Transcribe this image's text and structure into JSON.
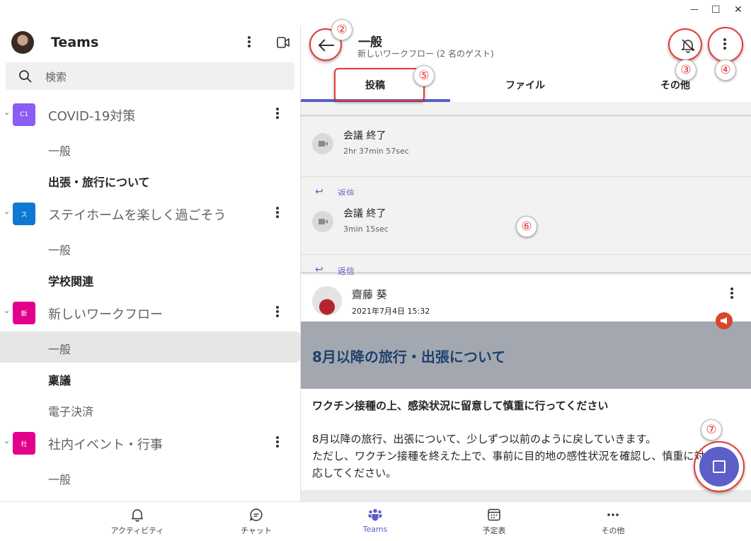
{
  "window": {
    "back_glyph": "←",
    "minimize_glyph": "—",
    "maximize_glyph": "☐",
    "close_glyph": "✕"
  },
  "left": {
    "title": "Teams",
    "search_placeholder": "検索",
    "teams": [
      {
        "badge": "C1",
        "name": "COVID-19対策",
        "color": "#8b5cf6",
        "channels": [
          {
            "name": "一般",
            "bold": false
          },
          {
            "name": "出張・旅行について",
            "bold": true
          }
        ]
      },
      {
        "badge": "ス",
        "name": "ステイホームを楽しく過ごそう",
        "color": "#0f78d4",
        "channels": [
          {
            "name": "一般",
            "bold": false
          },
          {
            "name": "学校関連",
            "bold": true
          }
        ]
      },
      {
        "badge": "新",
        "name": "新しいワークフロー",
        "color": "#e3008c",
        "channels": [
          {
            "name": "一般",
            "bold": false,
            "selected": true
          },
          {
            "name": "稟議",
            "bold": true
          },
          {
            "name": "電子決済",
            "bold": false
          }
        ]
      },
      {
        "badge": "社",
        "name": "社内イベント・行事",
        "color": "#e3008c",
        "channels": [
          {
            "name": "一般",
            "bold": false
          }
        ]
      }
    ]
  },
  "header": {
    "title": "一般",
    "subtitle": "新しいワークフロー (2 名のゲスト)"
  },
  "tabs": [
    "投稿",
    "ファイル",
    "その他"
  ],
  "feed": {
    "meetings": [
      {
        "title": "会議 終了",
        "duration": "2hr 37min 57sec",
        "reply": "返信"
      },
      {
        "title": "会議 終了",
        "duration": "3min 15sec",
        "reply": "返信"
      }
    ],
    "post": {
      "author": "齋藤 葵",
      "date": "2021年7月4日 15:32",
      "banner_title": "8月以降の旅行・出張について",
      "subject": "ワクチン接種の上、感染状況に留意して慎重に行ってください",
      "body_lines": [
        "8月以降の旅行、出張について、少しずつ以前のように戻していきます。",
        "ただし、ワクチン接種を終えた上で、事前に目的地の感性状況を確認し、慎重に対",
        "応してください。"
      ]
    }
  },
  "bottom_nav": [
    "アクティビティ",
    "チャット",
    "Teams",
    "予定表",
    "その他"
  ],
  "annotations": [
    "②",
    "③",
    "④",
    "⑤",
    "⑥",
    "⑦"
  ],
  "colors": {
    "accent": "#5b5fc7",
    "annotation": "#e53935"
  }
}
